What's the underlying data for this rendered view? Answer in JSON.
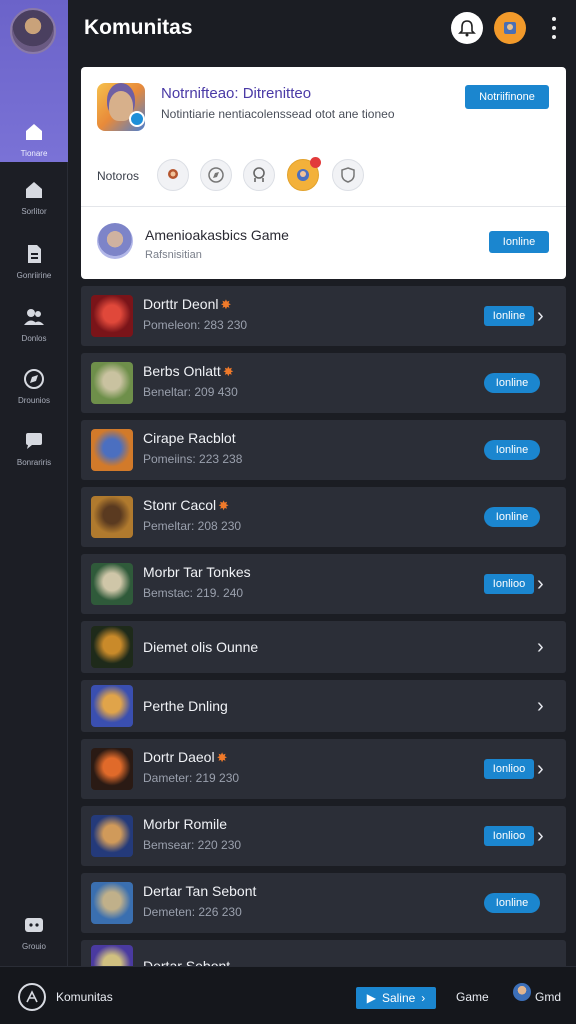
{
  "header": {
    "title": "Komunitas"
  },
  "sidebar": {
    "items": [
      {
        "label": ""
      },
      {
        "label": "Tionare"
      },
      {
        "label": "Sorlitor"
      },
      {
        "label": "Gonriirine"
      },
      {
        "label": "Donlos"
      },
      {
        "label": "Drounios"
      },
      {
        "label": "Bonrariris"
      },
      {
        "label": "Grouio"
      }
    ]
  },
  "card": {
    "title": "Notrnifteao: Ditrenitteo",
    "desc": "Notintiarie nentiacolenssead otot ane tioneo",
    "button": "Notriifinone",
    "members_label": "Notoros",
    "game_title": "Amenioakasbics Game",
    "game_sub": "Rafsnisitian",
    "game_button": "Ionline"
  },
  "list": [
    {
      "title": "Dorttr Deonl",
      "sub": "Pomeleon: 283 230",
      "btn": "Ionline",
      "chevron": true,
      "fire": true,
      "thumb": [
        "#7a1419",
        "#e0483a"
      ]
    },
    {
      "title": "Berbs Onlatt",
      "sub": "Beneltar: 209 430",
      "btn": "Ionline",
      "chevron": false,
      "fire": true,
      "thumb": [
        "#6e8f4a",
        "#c9c2a0"
      ]
    },
    {
      "title": "Cirape Racblot",
      "sub": "Pomeiins: 223 238",
      "btn": "Ionline",
      "chevron": false,
      "fire": false,
      "thumb": [
        "#d27a2a",
        "#4b6fc0"
      ]
    },
    {
      "title": "Stonr Cacol",
      "sub": "Pemeltar: 208 230",
      "btn": "Ionline",
      "chevron": false,
      "fire": true,
      "thumb": [
        "#b07a2e",
        "#5a3a20"
      ]
    },
    {
      "title": "Morbr Tar Tonkes",
      "sub": "Bemstac: 219. 240",
      "btn": "Ionlioo",
      "chevron": true,
      "fire": false,
      "thumb": [
        "#2f5a3a",
        "#cfc6a8"
      ]
    },
    {
      "title": "Diemet olis Ounne",
      "sub": "",
      "btn": "",
      "chevron": true,
      "fire": false,
      "thumb": [
        "#1e2a1a",
        "#c98a2a"
      ]
    },
    {
      "title": "Perthe Dnling",
      "sub": "",
      "btn": "",
      "chevron": true,
      "fire": false,
      "thumb": [
        "#3a4fb0",
        "#e0a44a"
      ]
    },
    {
      "title": "Dortr Daeol",
      "sub": "Dameter: 219 230",
      "btn": "Ionlioo",
      "chevron": true,
      "fire": true,
      "thumb": [
        "#2a1a14",
        "#e06a2a"
      ]
    },
    {
      "title": "Morbr Romile",
      "sub": "Bemsear: 220 230",
      "btn": "Ionlioo",
      "chevron": true,
      "fire": false,
      "thumb": [
        "#243a7a",
        "#d09a5a"
      ]
    },
    {
      "title": "Dertar Tan Sebont",
      "sub": "Demeten: 226 230",
      "btn": "Ionline",
      "chevron": false,
      "fire": false,
      "thumb": [
        "#3a6fb0",
        "#c0b08a"
      ]
    },
    {
      "title": "Dertar Sebont",
      "sub": "",
      "btn": "",
      "chevron": false,
      "fire": false,
      "thumb": [
        "#4a3aa0",
        "#d0c080"
      ]
    }
  ],
  "bottombar": {
    "label": "Komunitas",
    "button": "Saline",
    "game": "Game",
    "user": "Gmd"
  },
  "colors": {
    "accent": "#1b86cf",
    "sidebar_active": "#6b63c9",
    "background": "#1b1d23",
    "row": "#2b2e37"
  }
}
